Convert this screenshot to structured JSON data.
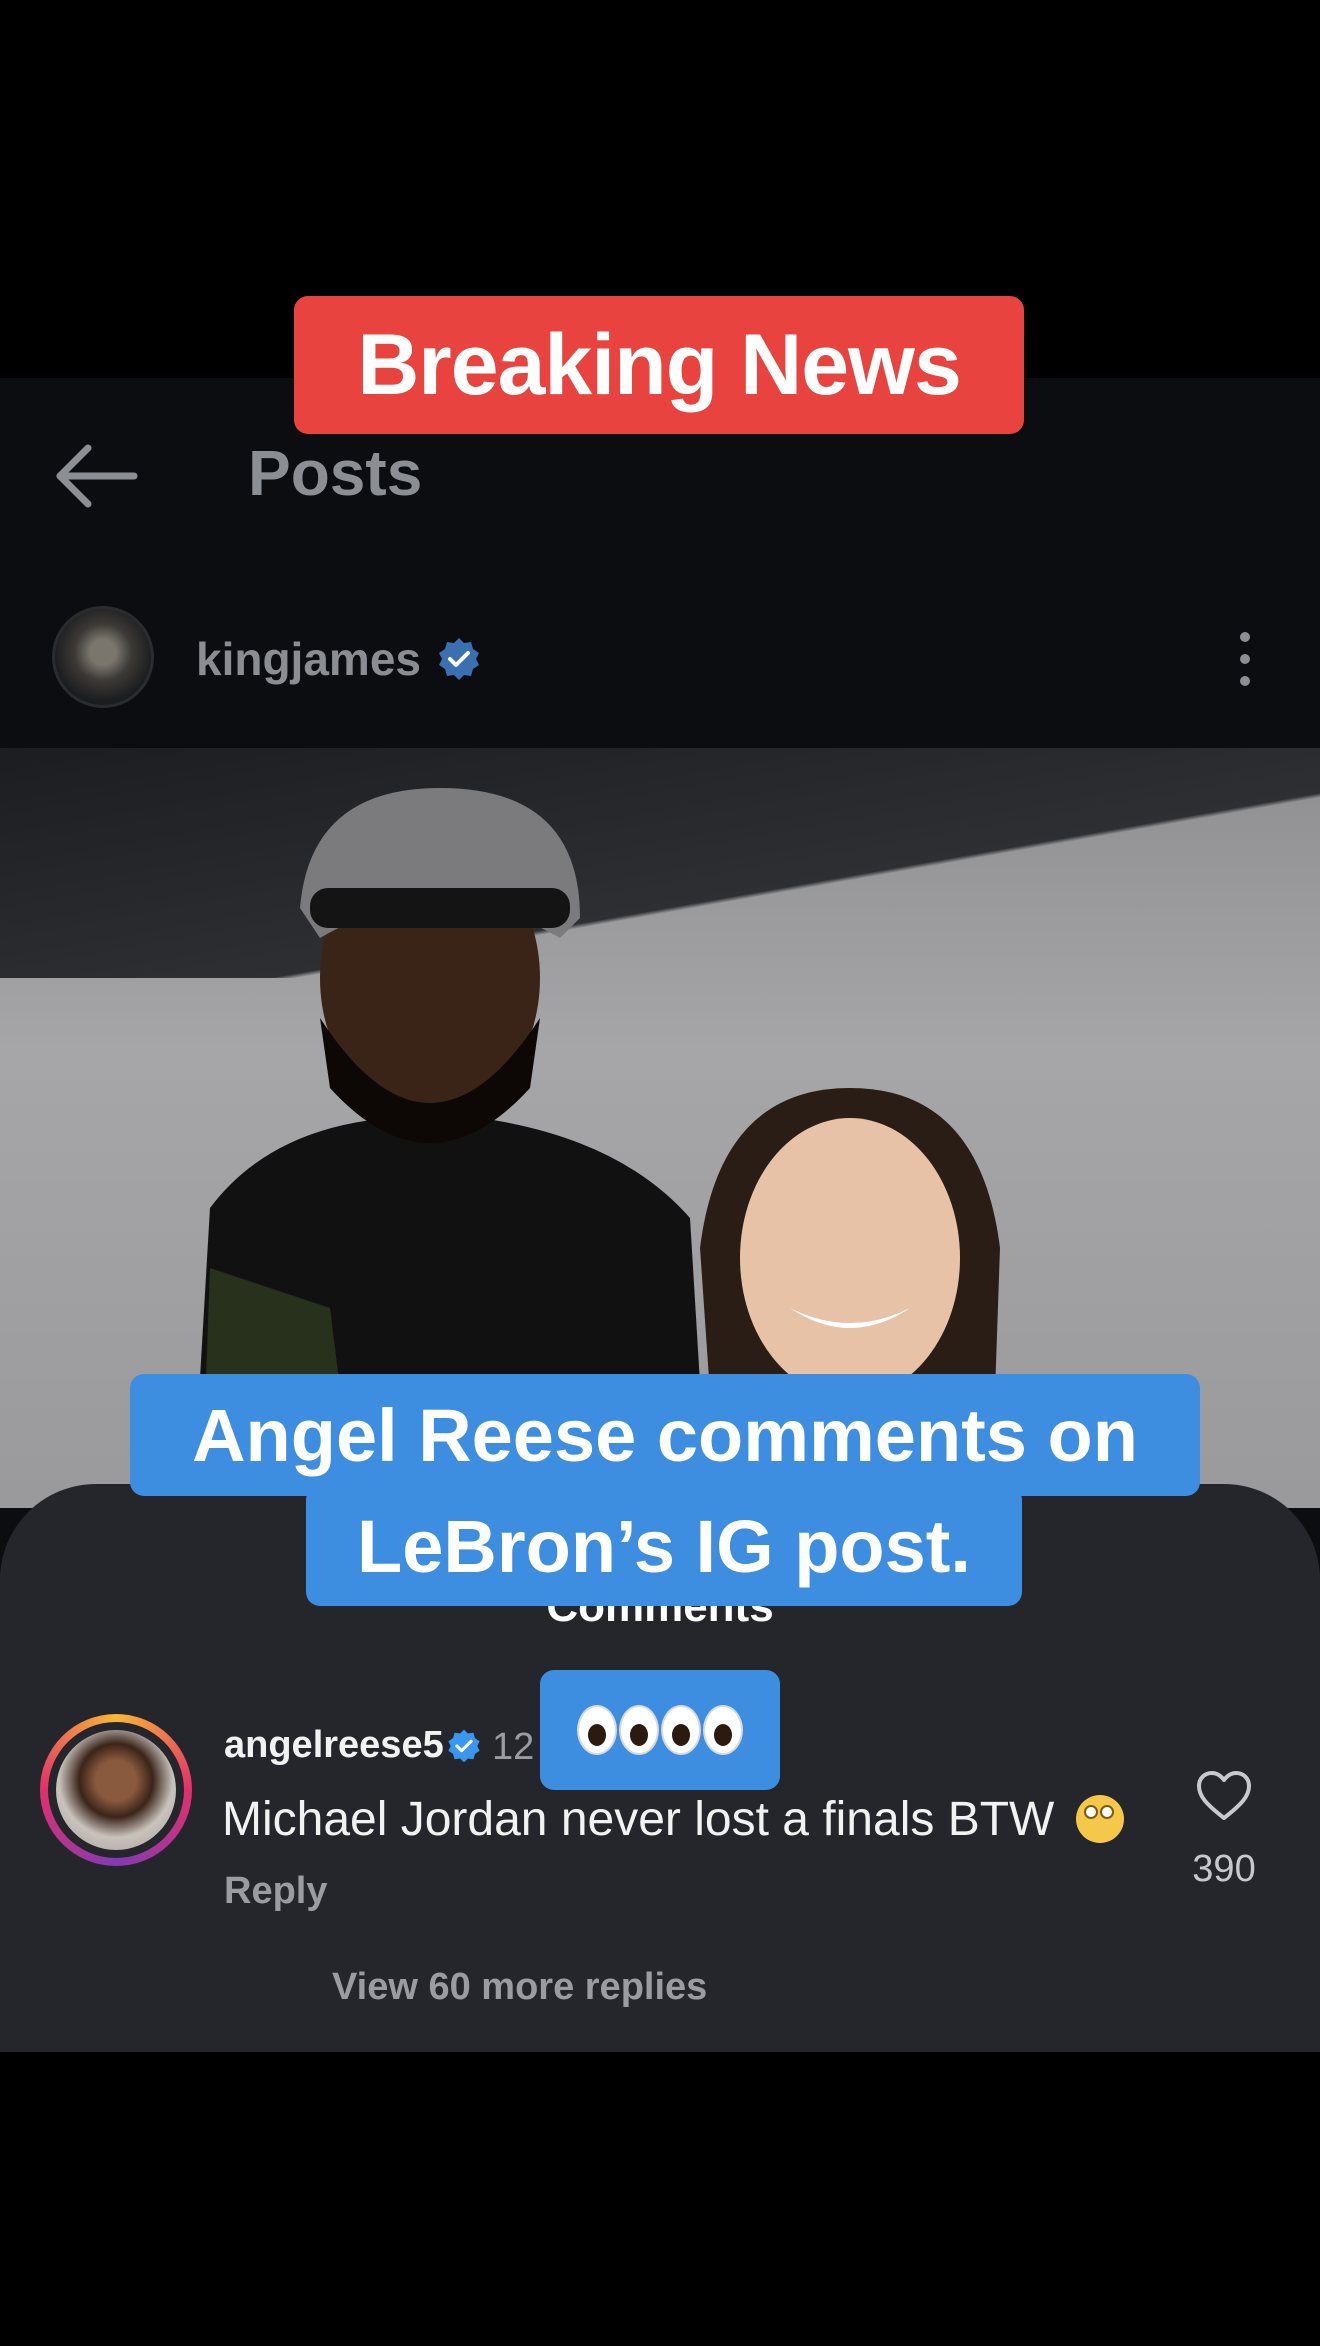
{
  "overlay": {
    "breaking_banner": "Breaking News",
    "caption_line_1": "Angel Reese comments on",
    "caption_line_2": "LeBron’s IG post."
  },
  "header": {
    "title": "Posts",
    "back_icon": "arrow-left-icon"
  },
  "post": {
    "username": "kingjames",
    "verified": true,
    "more_icon": "more-vertical-icon"
  },
  "comments_sheet": {
    "heading": "Comments",
    "comment": {
      "username": "angelreese5",
      "verified": true,
      "time": "12",
      "text": "Michael Jordan never lost a finals BTW",
      "emoji": "face-with-rolling-eyes",
      "reply_label": "Reply",
      "like_count": "390"
    },
    "view_more_label": "View 60 more replies",
    "eyes_emoji_count": 4
  },
  "colors": {
    "breaking_red": "#e9433f",
    "caption_blue": "#3d8ee0",
    "verified_blue": "#3897f0",
    "sheet_bg": "#24262c"
  }
}
